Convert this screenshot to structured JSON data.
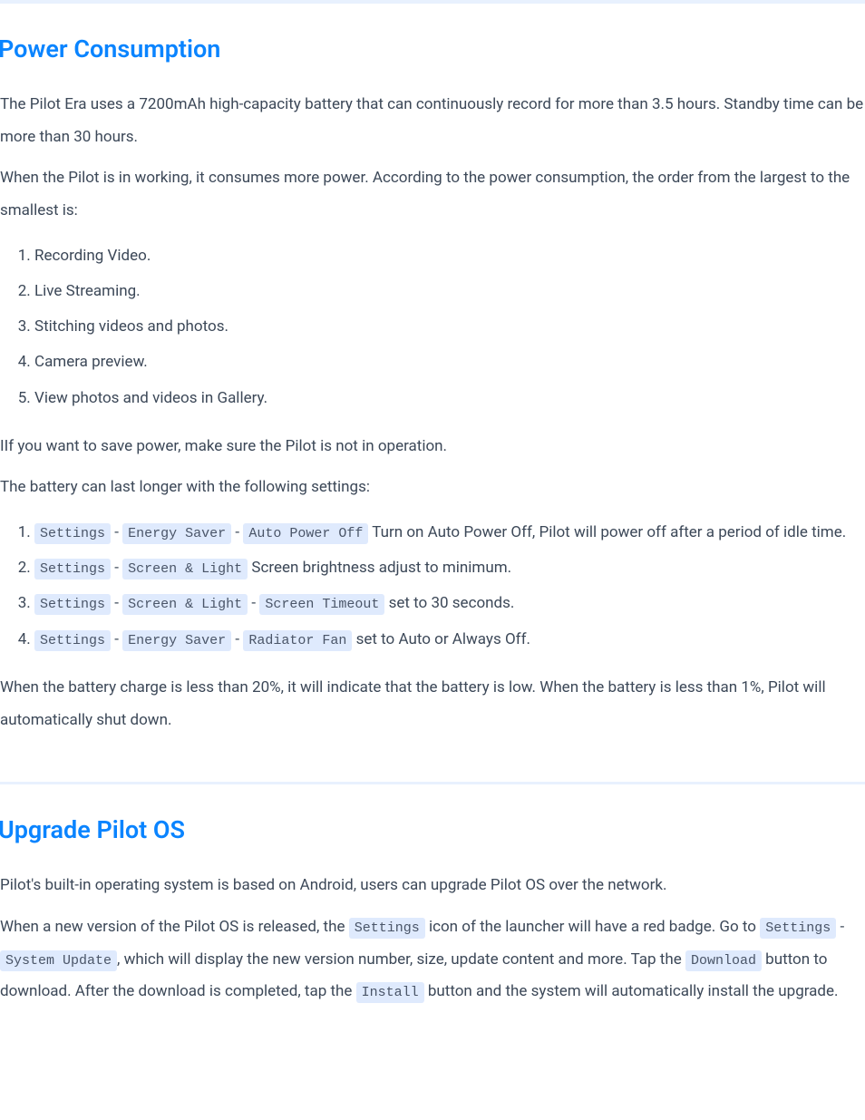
{
  "section1": {
    "heading": "Power Consumption",
    "p1": "The Pilot Era uses a 7200mAh high-capacity battery that can continuously record for more than 3.5 hours. Standby time can be more than 30 hours.",
    "p2": "When the Pilot is in working, it consumes more power. According to the power consumption, the order from the largest to the smallest is:",
    "list1": {
      "item1": "Recording Video.",
      "item2": "Live Streaming.",
      "item3": "Stitching videos and photos.",
      "item4": "Camera preview.",
      "item5": "View photos and videos in Gallery."
    },
    "p3": "IIf you want to save power, make sure the Pilot is not in operation.",
    "p4": "The battery can last longer with the following settings:",
    "list2": {
      "item1": {
        "code1": "Settings",
        "sep1": " - ",
        "code2": "Energy Saver",
        "sep2": " - ",
        "code3": "Auto Power Off",
        "tail": " Turn on Auto Power Off, Pilot will power off after a period of idle time."
      },
      "item2": {
        "code1": "Settings",
        "sep1": " - ",
        "code2": "Screen & Light",
        "tail": " Screen brightness adjust to minimum."
      },
      "item3": {
        "code1": "Settings",
        "sep1": " - ",
        "code2": "Screen & Light",
        "sep2": " - ",
        "code3": "Screen Timeout",
        "tail": " set to 30 seconds."
      },
      "item4": {
        "code1": "Settings",
        "sep1": " - ",
        "code2": "Energy Saver",
        "sep2": " - ",
        "code3": "Radiator Fan",
        "tail": " set to Auto or Always Off."
      }
    },
    "p5": "When the battery charge is less than 20%, it will indicate that the battery is low. When the battery is less than 1%, Pilot will automatically shut down."
  },
  "section2": {
    "heading": "Upgrade Pilot OS",
    "p1": "Pilot's built-in operating system is based on Android, users can upgrade Pilot OS over the network.",
    "p2": {
      "t1": "When a new version of the Pilot OS is released, the ",
      "code1": "Settings",
      "t2": " icon of the launcher will have a red badge. Go to ",
      "code2": "Settings",
      "t3": " - ",
      "code3": "System Update",
      "t4": ", which will display the new version number, size, update content and more. Tap the ",
      "code4": "Download",
      "t5": " button to download. After the download is completed, tap the ",
      "code5": "Install",
      "t6": " button and the system will automatically install the upgrade."
    }
  }
}
